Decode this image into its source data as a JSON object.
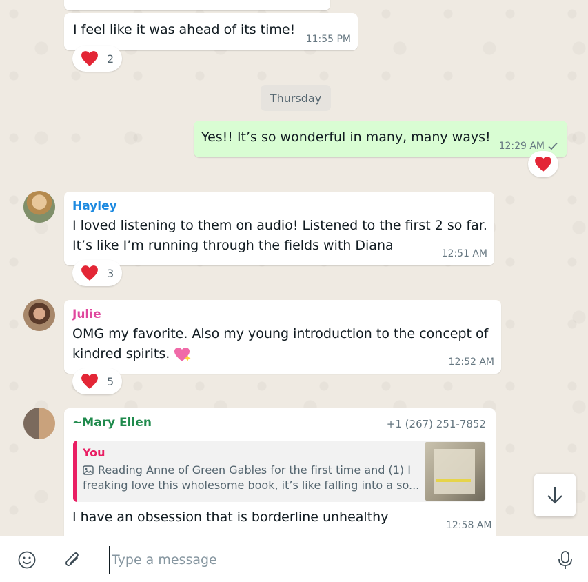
{
  "messages": [
    {
      "text": "I feel like it was ahead of its time!",
      "time": "11:55 PM",
      "reaction_count": "2"
    },
    {
      "text": "Yes!! It’s so wonderful in many, many ways!",
      "time": "12:29 AM",
      "status_icon": "single-check-icon"
    },
    {
      "sender": "Hayley",
      "text_lines": [
        "I loved listening to them on audio! Listened to the first 2 so far.",
        "It’s like I’m running through the fields with Diana"
      ],
      "time": "12:51 AM",
      "reaction_count": "3"
    },
    {
      "sender": "Julie",
      "text_lines": [
        "OMG my favorite. Also my young introduction to the concept of",
        "kindred spirits."
      ],
      "time": "12:52 AM",
      "reaction_count": "5",
      "emoji": "sparkling-heart"
    },
    {
      "sender": "~Mary Ellen",
      "phone": "+1 (267) 251-7852",
      "quote": {
        "author": "You",
        "text_lines": [
          "Reading Anne of Green Gables for the first time and (1) I",
          "freaking love this wholesome book, it’s like falling into a so..."
        ],
        "thumbnail": "book-page-photo"
      },
      "text": "I have an obsession that is borderline unhealthy",
      "time": "12:58 AM"
    }
  ],
  "day_separator": "Thursday",
  "composer": {
    "placeholder": "Type a message"
  },
  "icons": [
    "emoji-icon",
    "paperclip-icon",
    "microphone-icon",
    "arrow-down-icon",
    "heart-icon",
    "image-icon"
  ],
  "colors": {
    "outgoing_bubble": "#d9fdd3",
    "incoming_bubble": "#ffffff",
    "hayley": "#1d8ae0",
    "julie": "#e0479e",
    "mary_ellen": "#1f8a4c",
    "quote_bar": "#e91e63",
    "background": "#efeae2"
  }
}
